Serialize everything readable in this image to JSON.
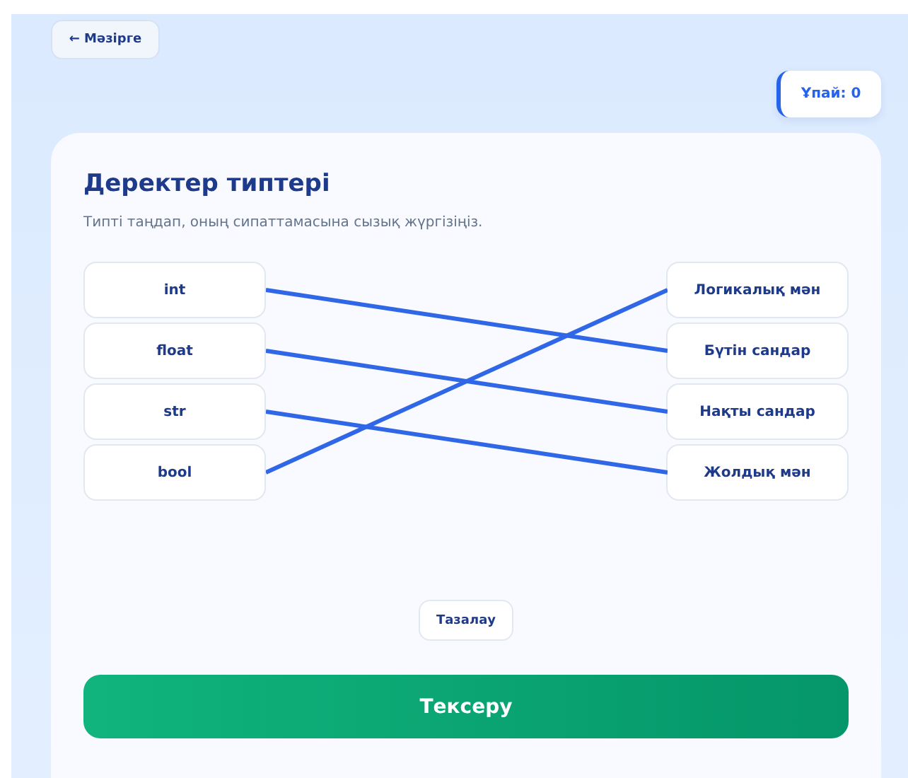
{
  "back_button": {
    "label": "← Мәзірге"
  },
  "score": {
    "label": "Ұпай: 0"
  },
  "card": {
    "title": "Деректер типтері",
    "instruction": "Типті таңдап, оның сипаттамасына сызық жүргізіңіз.",
    "left_items": [
      {
        "label": "int",
        "linked_to": [
          false,
          true,
          false,
          false
        ]
      },
      {
        "label": "float",
        "linked_to": [
          false,
          false,
          true,
          false
        ]
      },
      {
        "label": "str",
        "linked_to": [
          false,
          false,
          false,
          true
        ]
      },
      {
        "label": "bool",
        "linked_to": [
          true,
          false,
          false,
          false
        ]
      }
    ],
    "right_items": [
      {
        "label": "Логикалық мән"
      },
      {
        "label": "Бүтін сандар"
      },
      {
        "label": "Нақты сандар"
      },
      {
        "label": "Жолдық мән"
      }
    ],
    "clear_button": {
      "label": "Тазалау"
    },
    "check_button": {
      "label": "Тексеру"
    }
  }
}
